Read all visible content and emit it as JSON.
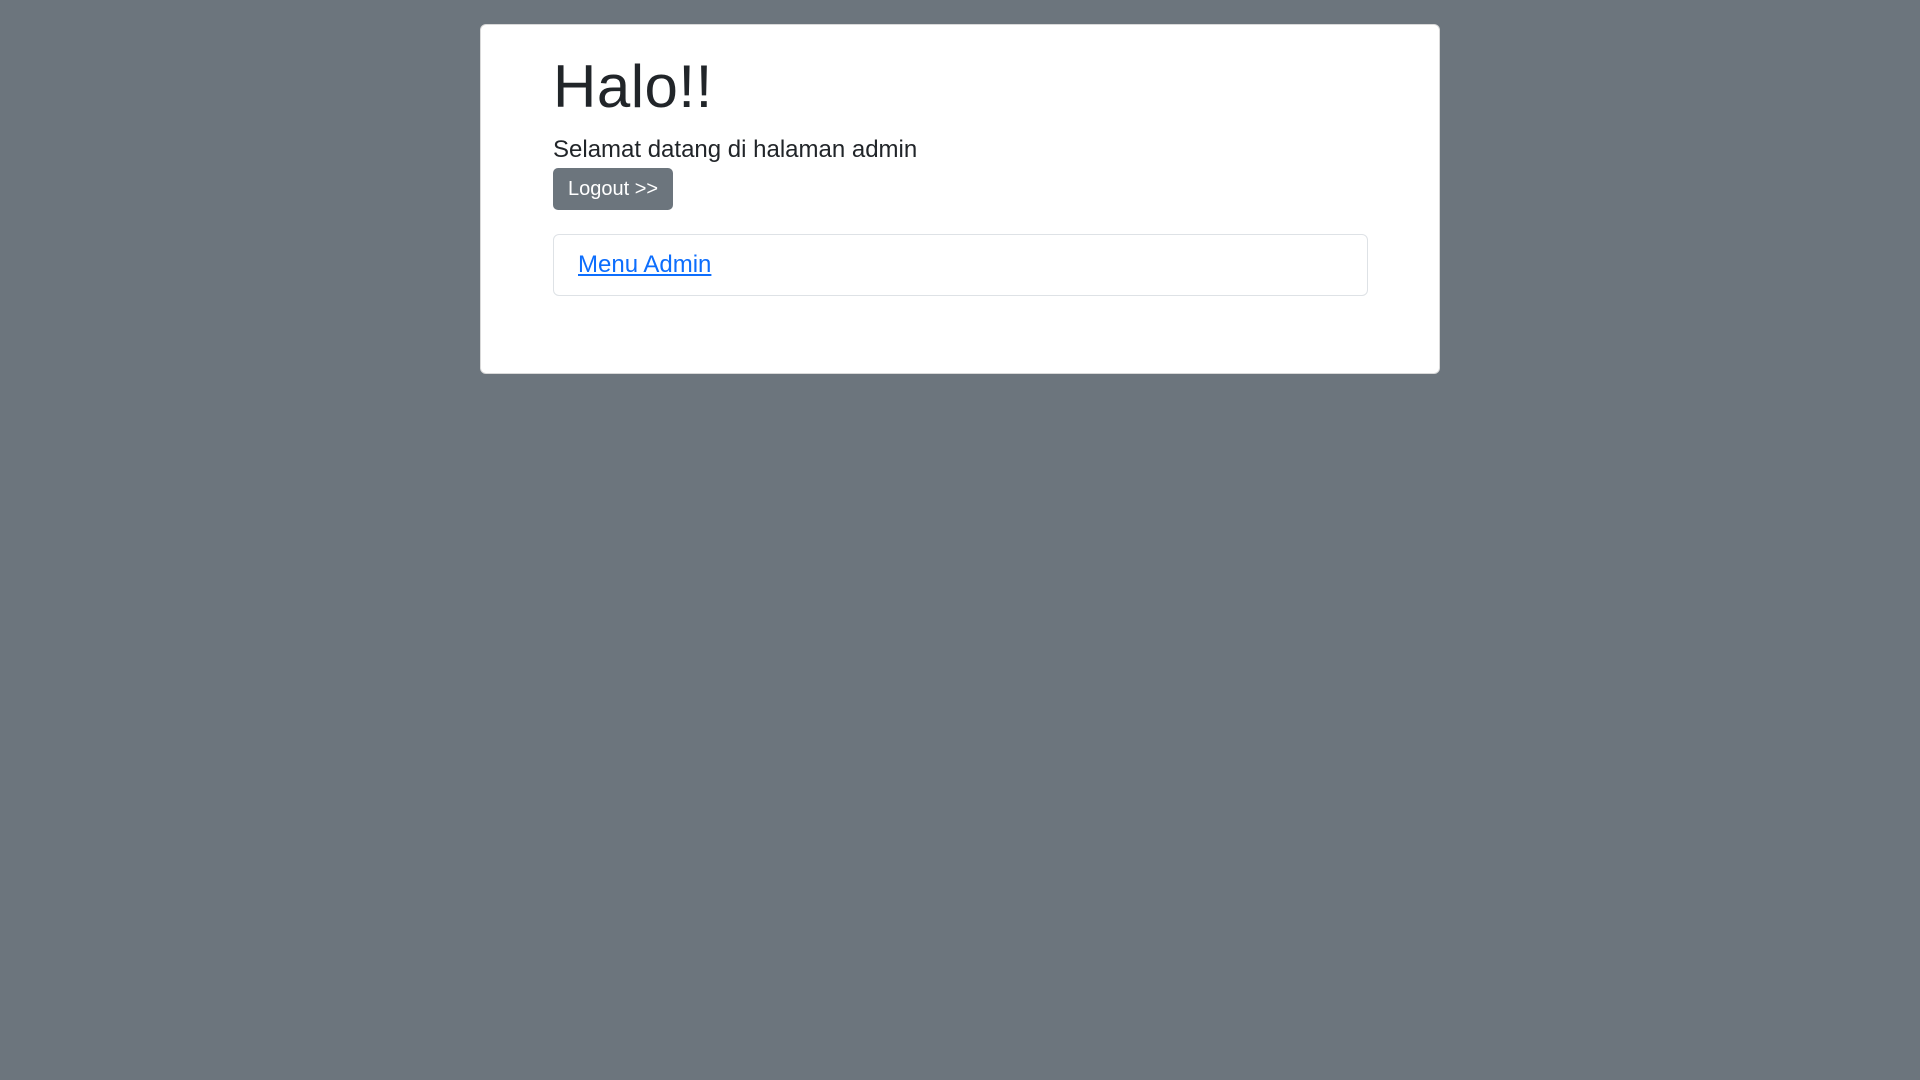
{
  "page": {
    "background_color": "#6c757d"
  },
  "header": {
    "title": "Halo!!",
    "welcome": "Selamat datang di halaman admin"
  },
  "actions": {
    "logout_label": "Logout >>"
  },
  "menu": {
    "items": [
      {
        "label": "Menu Admin",
        "color": "#0d6efd"
      }
    ]
  }
}
